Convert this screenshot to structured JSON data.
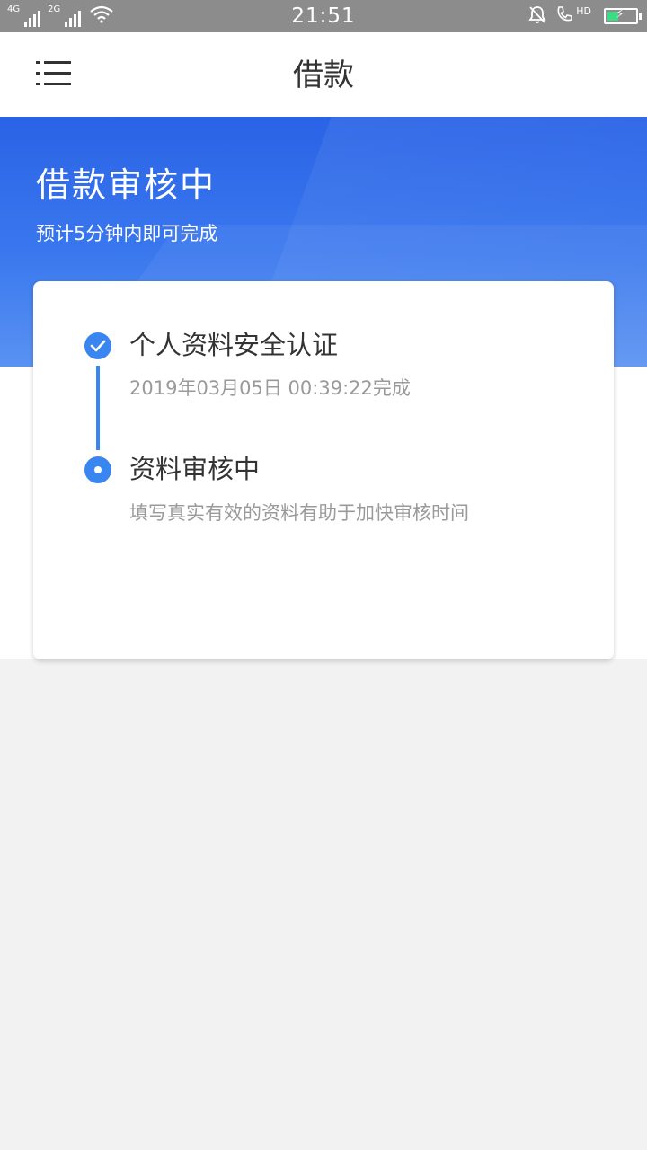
{
  "status_bar": {
    "network_1": "4G",
    "network_2": "2G",
    "time": "21:51",
    "hd": "HD",
    "battery_level": 0.35
  },
  "header": {
    "title": "借款"
  },
  "banner": {
    "title": "借款审核中",
    "subtitle": "预计5分钟内即可完成"
  },
  "steps": [
    {
      "title": "个人资料安全认证",
      "desc": "2019年03月05日 00:39:22完成",
      "state": "done"
    },
    {
      "title": "资料审核中",
      "desc": "填写真实有效的资料有助于加快审核时间",
      "state": "current"
    }
  ],
  "colors": {
    "accent": "#3a86f0",
    "banner": "#2a63e6",
    "background": "#f2f2f2"
  }
}
